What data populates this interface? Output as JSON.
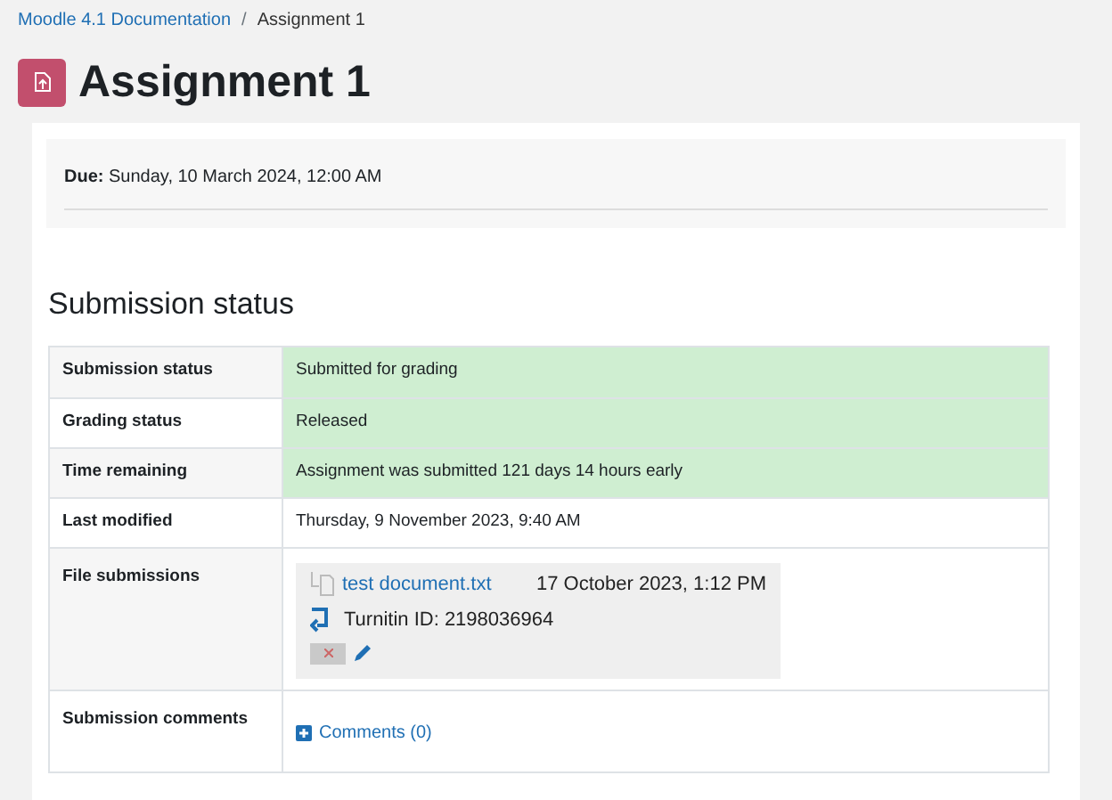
{
  "breadcrumb_separator": "/",
  "breadcrumb": [
    {
      "label": "Moodle 4.1 Documentation",
      "link": true
    },
    {
      "label": "Assignment 1",
      "link": false
    }
  ],
  "title": "Assignment 1",
  "due": {
    "label": "Due:",
    "value": "Sunday, 10 March 2024, 12:00 AM"
  },
  "section_title": "Submission status",
  "rows": [
    {
      "label": "Submission status",
      "kind": "text",
      "highlight": true,
      "value": "Submitted for grading"
    },
    {
      "label": "Grading status",
      "kind": "text",
      "highlight": true,
      "value": "Released"
    },
    {
      "label": "Time remaining",
      "kind": "text",
      "highlight": true,
      "value": "Assignment was submitted 121 days 14 hours early"
    },
    {
      "label": "Last modified",
      "kind": "text",
      "highlight": false,
      "value": "Thursday, 9 November 2023, 9:40 AM"
    },
    {
      "label": "File submissions",
      "kind": "files",
      "highlight": false,
      "file": {
        "name": "test document.txt",
        "date": "17 October 2023, 1:12 PM",
        "turnitin": "Turnitin ID: 2198036964"
      }
    },
    {
      "label": "Submission comments",
      "kind": "comments",
      "highlight": false,
      "link": "Comments (0)"
    }
  ]
}
